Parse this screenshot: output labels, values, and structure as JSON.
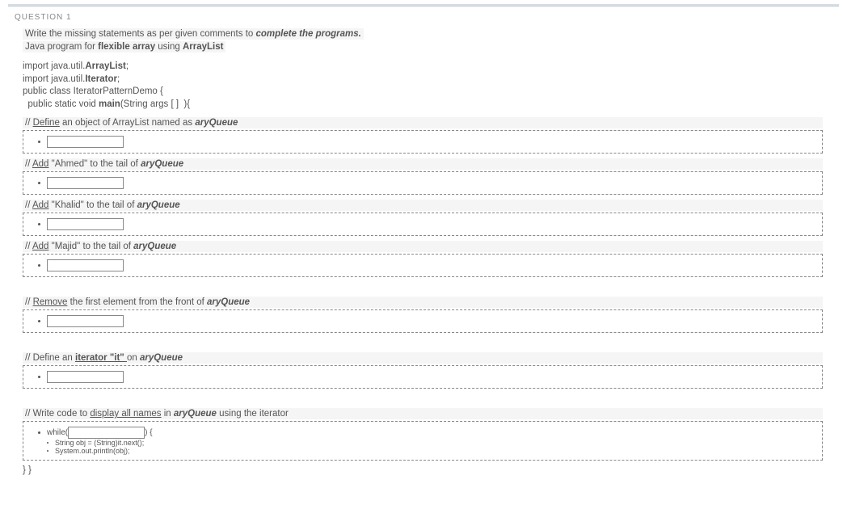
{
  "header": "QUESTION 1",
  "prompt": {
    "line1_a": "Write the missing statements as per given comments to ",
    "line1_b": "complete the programs.",
    "line2_a": "Java program for ",
    "line2_b": "flexible array",
    "line2_c": " using ",
    "line2_d": "ArrayList"
  },
  "code": {
    "l1_a": "import java.util.",
    "l1_b": "ArrayList",
    "l1_c": ";",
    "l2_a": "import java.util.",
    "l2_b": "Iterator",
    "l2_c": ";",
    "l3": "public class IteratorPatternDemo {",
    "l4_a": "  public static void ",
    "l4_b": "main",
    "l4_c": "(String args [ ]  ){"
  },
  "comments": {
    "c1_a": "// ",
    "c1_b": "Define",
    "c1_c": " an object of ArrayList named as ",
    "c1_d": "aryQueue",
    "c2_a": "// ",
    "c2_b": "Add",
    "c2_c": " \"Ahmed\" to the tail of ",
    "c2_d": "aryQueue",
    "c3_a": "// ",
    "c3_b": "Add",
    "c3_c": " \"Khalid\" to the tail of ",
    "c3_d": "aryQueue",
    "c4_a": "// ",
    "c4_b": "Add",
    "c4_c": " \"Majid\" to the tail of ",
    "c4_d": "aryQueue",
    "c5_a": "// ",
    "c5_b": "Remove",
    "c5_c": " the first element from the front of ",
    "c5_d": "aryQueue",
    "c6_a": "// Define an ",
    "c6_b": "iterator  \"it\" ",
    "c6_c": " on ",
    "c6_d": "aryQueue",
    "c7_a": "// Write code to ",
    "c7_b": "display all names",
    "c7_c": " in ",
    "c7_d": "aryQueue",
    "c7_e": "  using the iterator"
  },
  "while_block": {
    "prefix": "while( ",
    "suffix": ") {",
    "line1": "String obj = (String)it.next();",
    "line2": "System.out.println(obj);"
  },
  "closing": "}  }",
  "inputs": {
    "v1": "",
    "v2": "",
    "v3": "",
    "v4": "",
    "v5": "",
    "v6": "",
    "v7": ""
  }
}
